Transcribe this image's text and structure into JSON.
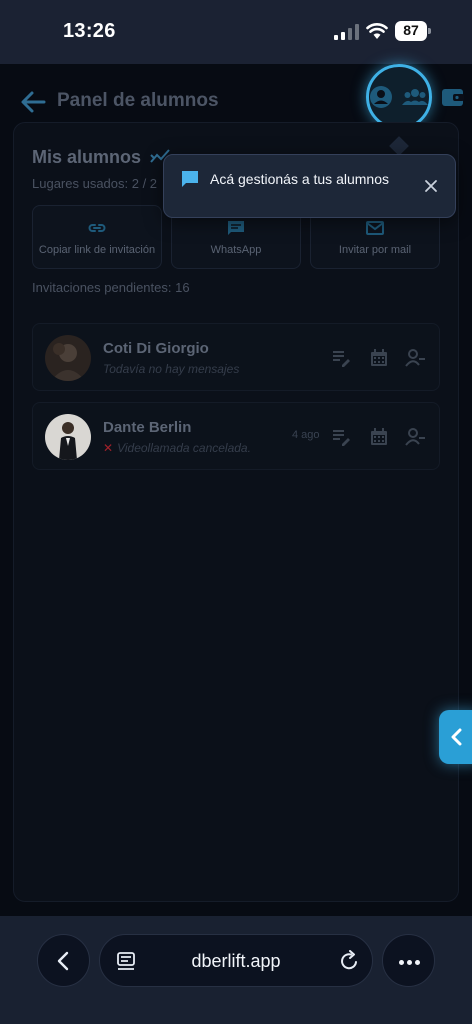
{
  "status_bar": {
    "time": "13:26",
    "battery": "87"
  },
  "header": {
    "title": "Panel de alumnos"
  },
  "panel": {
    "title": "Mis alumnos",
    "slots_text": "Lugares usados: 2 / 2",
    "actions": [
      {
        "label": "Copiar link de invitación",
        "icon": "link-icon"
      },
      {
        "label": "WhatsApp",
        "icon": "chat-icon"
      },
      {
        "label": "Invitar por mail",
        "icon": "mail-icon"
      }
    ],
    "pending_text": "Invitaciones pendientes: 16"
  },
  "students": [
    {
      "name": "Coti Di Giorgio",
      "message": "Todavía no hay mensajes",
      "time": ""
    },
    {
      "name": "Dante Berlin",
      "message": "Videollamada cancelada.",
      "time": "4 ago"
    }
  ],
  "tooltip": {
    "text": "Acá gestionás a tus alumnos"
  },
  "browser": {
    "url": "dberlift.app"
  },
  "colors": {
    "accent": "#3fb1e6",
    "side_tab": "#2a9fd6",
    "cancel_x": "#a0212a"
  }
}
